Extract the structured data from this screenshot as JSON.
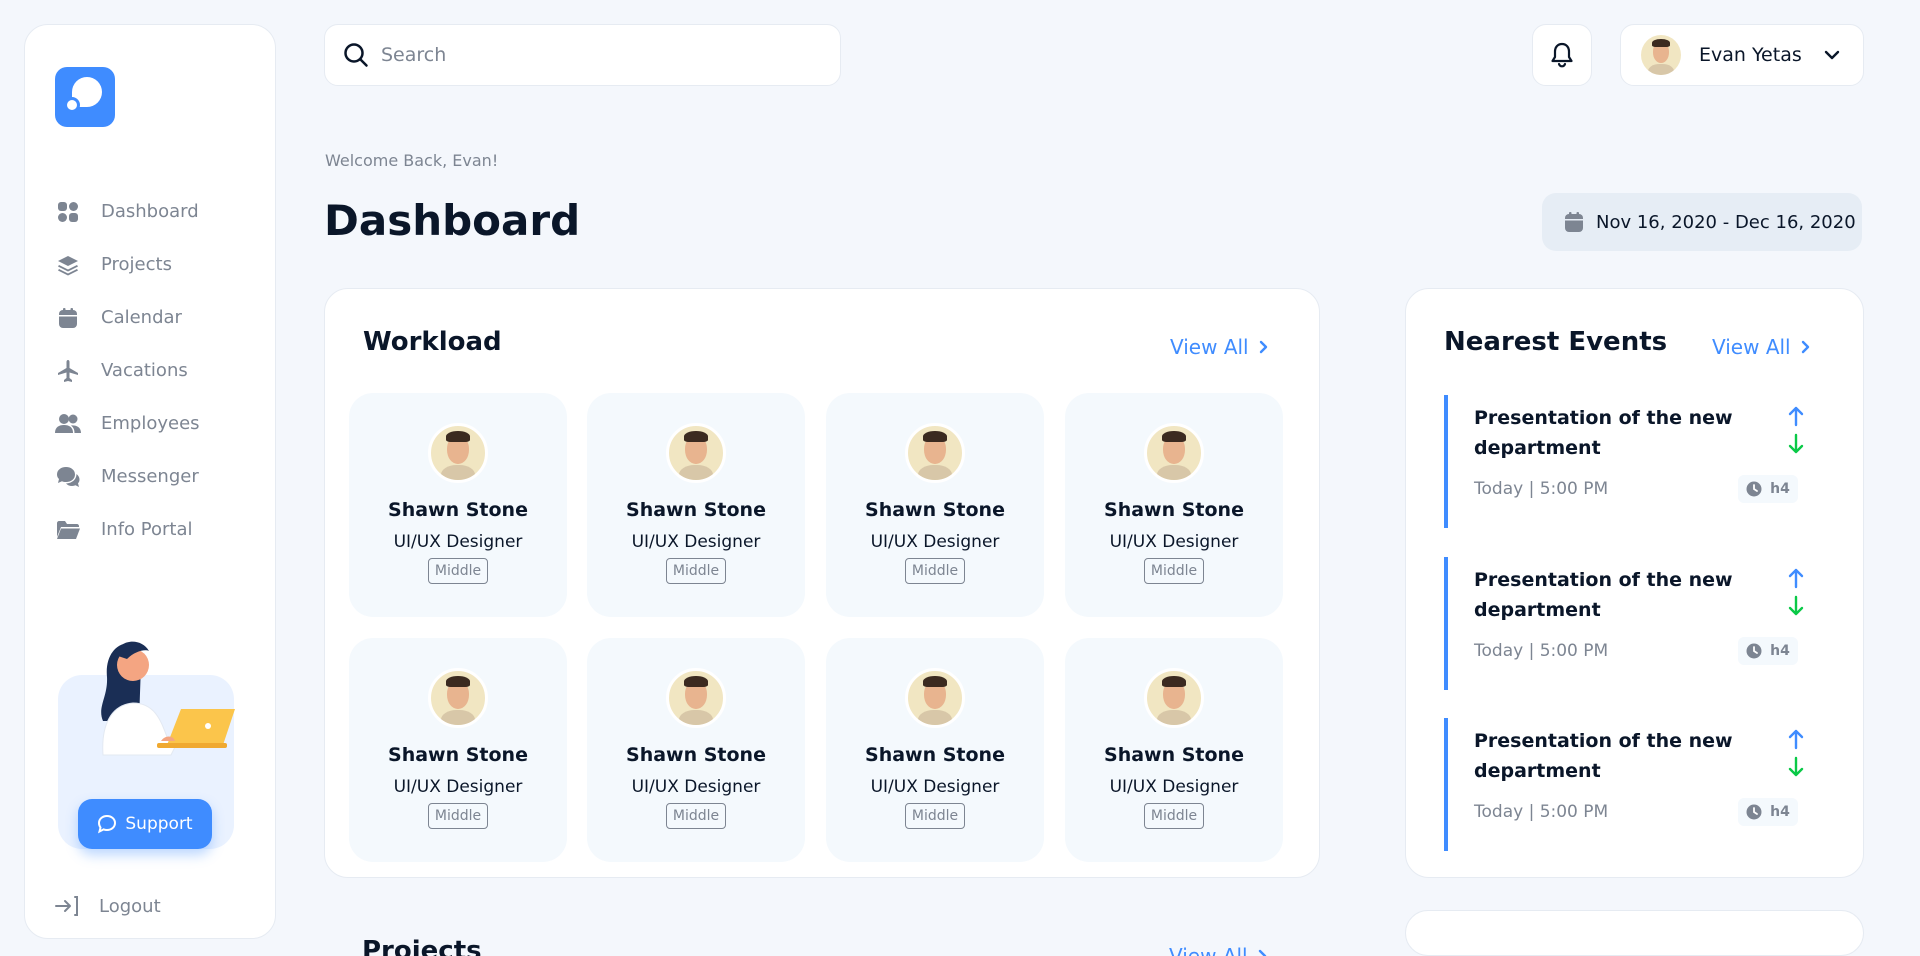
{
  "sidebar": {
    "items": [
      {
        "label": "Dashboard",
        "icon": "dashboard-icon"
      },
      {
        "label": "Projects",
        "icon": "layers-icon"
      },
      {
        "label": "Calendar",
        "icon": "calendar-icon"
      },
      {
        "label": "Vacations",
        "icon": "plane-icon"
      },
      {
        "label": "Employees",
        "icon": "users-icon"
      },
      {
        "label": "Messenger",
        "icon": "chat-icon"
      },
      {
        "label": "Info Portal",
        "icon": "folder-icon"
      }
    ],
    "support_label": "Support",
    "logout_label": "Logout"
  },
  "search": {
    "placeholder": "Search"
  },
  "user": {
    "name": "Evan Yetas"
  },
  "header": {
    "welcome": "Welcome Back, Evan!",
    "title": "Dashboard",
    "date_range": "Nov 16, 2020 - Dec 16, 2020"
  },
  "workload": {
    "title": "Workload",
    "view_all": "View All",
    "employees": [
      {
        "name": "Shawn Stone",
        "role": "UI/UX Designer",
        "level": "Middle"
      },
      {
        "name": "Shawn Stone",
        "role": "UI/UX Designer",
        "level": "Middle"
      },
      {
        "name": "Shawn Stone",
        "role": "UI/UX Designer",
        "level": "Middle"
      },
      {
        "name": "Shawn Stone",
        "role": "UI/UX Designer",
        "level": "Middle"
      },
      {
        "name": "Shawn Stone",
        "role": "UI/UX Designer",
        "level": "Middle"
      },
      {
        "name": "Shawn Stone",
        "role": "UI/UX Designer",
        "level": "Middle"
      },
      {
        "name": "Shawn Stone",
        "role": "UI/UX Designer",
        "level": "Middle"
      },
      {
        "name": "Shawn Stone",
        "role": "UI/UX Designer",
        "level": "Middle"
      }
    ]
  },
  "events": {
    "title": "Nearest Events",
    "view_all": "View All",
    "items": [
      {
        "title": "Presentation of the new department",
        "time": "Today | 5:00 PM",
        "duration": "h4"
      },
      {
        "title": "Presentation of the new department",
        "time": "Today | 5:00 PM",
        "duration": "h4"
      },
      {
        "title": "Presentation of the new department",
        "time": "Today | 5:00 PM",
        "duration": "h4"
      }
    ]
  },
  "projects": {
    "title": "Projects",
    "view_all": "View All"
  },
  "colors": {
    "accent": "#3f8cff",
    "up_arrow": "#3f8cff",
    "down_arrow": "#0ac947"
  }
}
